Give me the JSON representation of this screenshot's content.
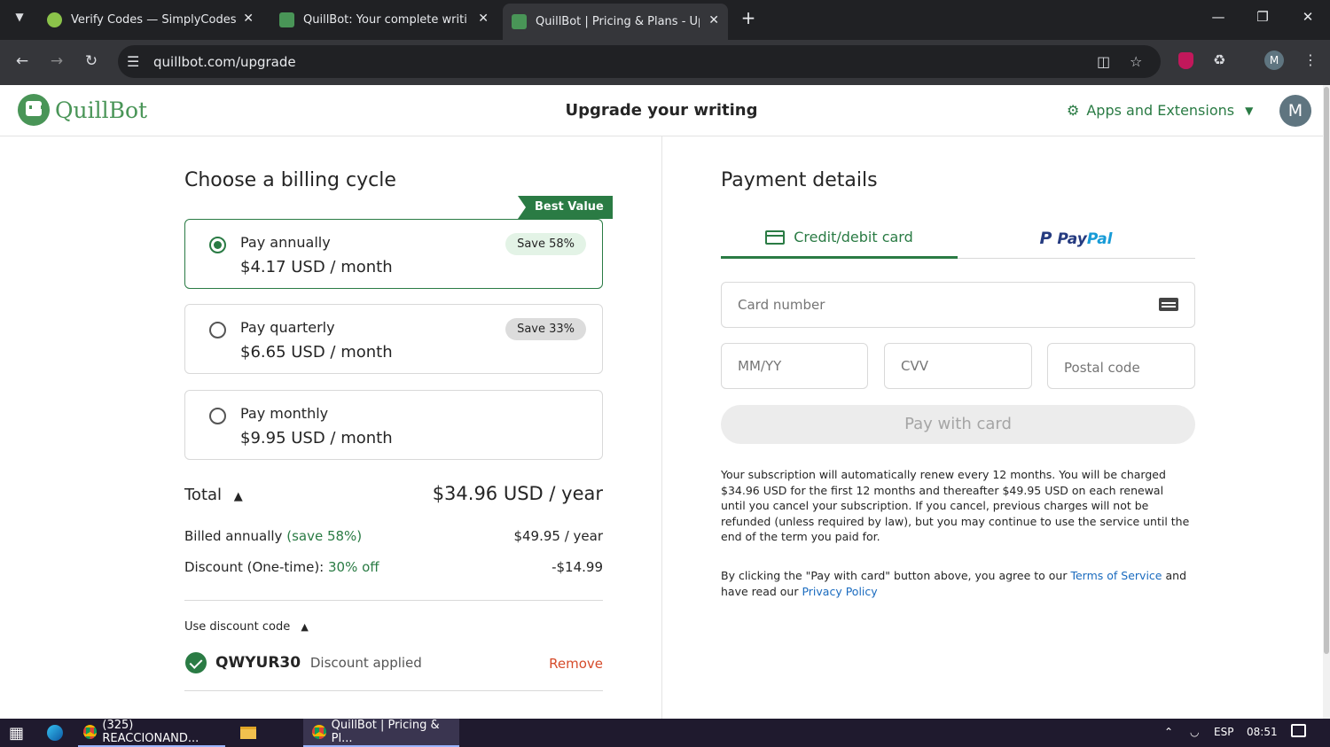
{
  "browser": {
    "tabs": [
      {
        "label": "Verify Codes — SimplyCodes"
      },
      {
        "label": "QuillBot: Your complete writing"
      },
      {
        "label": "QuillBot | Pricing & Plans - Upg"
      }
    ],
    "new_tab": "+",
    "url": "quillbot.com/upgrade",
    "profile_initial": "M"
  },
  "header": {
    "brand": "QuillBot",
    "title": "Upgrade your writing",
    "apps": "Apps and Extensions",
    "avatar": "M"
  },
  "billing": {
    "heading": "Choose a billing cycle",
    "best_value": "Best Value",
    "plans": [
      {
        "name": "Pay annually",
        "price": "$4.17 USD / month",
        "save": "Save 58%",
        "selected": true
      },
      {
        "name": "Pay quarterly",
        "price": "$6.65 USD / month",
        "save": "Save 33%",
        "selected": false
      },
      {
        "name": "Pay monthly",
        "price": "$9.95 USD / month",
        "save": "",
        "selected": false
      }
    ],
    "total_label": "Total",
    "total_value": "$34.96 USD / year",
    "billed_label": "Billed annually",
    "billed_save": "(save 58%)",
    "billed_value": "$49.95 / year",
    "discount_label": "Discount (One-time):",
    "discount_pct": "30% off",
    "discount_value": "-$14.99",
    "code_toggle": "Use discount code",
    "code": "QWYUR30",
    "code_status": "Discount applied",
    "remove": "Remove"
  },
  "payment": {
    "heading": "Payment details",
    "tab_card": "Credit/debit card",
    "tab_paypal_pay": "Pay",
    "tab_paypal_pal": "Pal",
    "card_placeholder": "Card number",
    "exp_placeholder": "MM/YY",
    "cvv_placeholder": "CVV",
    "postal_placeholder": "Postal code",
    "pay_button": "Pay with card",
    "renew_text": "Your subscription will automatically renew every 12 months. You will be charged $34.96 USD for the first 12 months and thereafter $49.95 USD on each renewal until you cancel your subscription. If you cancel, previous charges will not be refunded (unless required by law), but you may continue to use the service until the end of the term you paid for.",
    "agree_prefix": "By clicking the \"Pay with card\" button above, you agree to our",
    "terms": "Terms of Service",
    "agree_mid": "and have read our",
    "privacy": "Privacy Policy"
  },
  "taskbar": {
    "item1": "(325) REACCIONAND...",
    "item2": "QuillBot | Pricing & Pl...",
    "lang": "ESP",
    "time": "08:51"
  },
  "colors": {
    "brand_green": "#2a7b44",
    "logo_green": "#499557",
    "link_blue": "#1a6bbf"
  }
}
